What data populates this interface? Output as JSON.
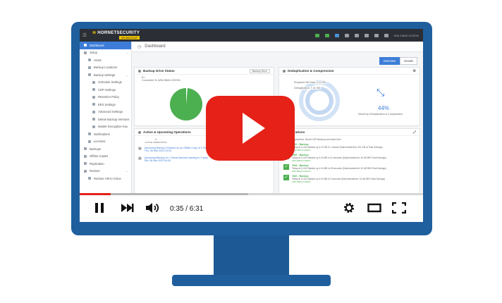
{
  "app": {
    "brand_line1": "HORNETSECURITY",
    "brand_line2": "VM BACKUP",
    "user": "WIN-DBA0-OCEDN"
  },
  "sidebar": {
    "items": [
      {
        "label": "Dashboard",
        "level": 1,
        "active": true
      },
      {
        "label": "Setup",
        "level": 1,
        "chevron": true
      },
      {
        "label": "Hosts",
        "level": 2
      },
      {
        "label": "Backup Locations",
        "level": 2
      },
      {
        "label": "Backup Settings",
        "level": 2,
        "chevron": true
      },
      {
        "label": "Schedule Settings",
        "level": 3
      },
      {
        "label": "CDP Settings",
        "level": 3
      },
      {
        "label": "Retention Policy",
        "level": 3
      },
      {
        "label": "EES Settings",
        "level": 3
      },
      {
        "label": "Advanced Settings",
        "level": 3
      },
      {
        "label": "Delete Backup Versions",
        "level": 3
      },
      {
        "label": "Master Encryption Key",
        "level": 3
      },
      {
        "label": "Notifications",
        "level": 2
      },
      {
        "label": "Licenses",
        "level": 2
      },
      {
        "label": "Backups",
        "level": 1
      },
      {
        "label": "Offsite Copies",
        "level": 1
      },
      {
        "label": "Replication",
        "level": 1
      },
      {
        "label": "Restore",
        "level": 1,
        "chevron": true
      },
      {
        "label": "Restore VM to Clone",
        "level": 2
      }
    ]
  },
  "page": {
    "title": "Dashboard",
    "tabs": [
      "Overview",
      "Details"
    ]
  },
  "panels": {
    "drive_status": {
      "title": "Backup Drive Status",
      "button": "Backup Drive",
      "drive_letter": "E:\\",
      "connected": "Connected To WIN-DBA0-OCEDN"
    },
    "dedup": {
      "title": "Deduplication & Compression",
      "prepared_label": "Prepared VM Data: 9.14 GB",
      "dedup_label": "Deduplication: 7.41 GB",
      "percent": "44%",
      "caption": "Saved by Deduplication & Compression"
    },
    "active_ops": {
      "title": "Active & Upcoming Operations",
      "active_count": "0",
      "active_label": "ACTIVE OPERATIONS",
      "queued_count": "0",
      "queued_label": "QUEUED OPERATIONS",
      "rows": [
        {
          "text": "Upcoming Backup Followed by an Offsite Copy of 3 VMs in 2 hours",
          "date": "Thu, 06 Mar 2023 23:00"
        },
        {
          "text": "Upcoming Backup of 1 Virtual Machine starting in 2 days",
          "date": "Sat, 08 Mar 2023 00:00"
        }
      ]
    },
    "recent_ops": {
      "title": "Operations",
      "notice": "Last 24 Operations. Not all CDP Backups are listed here",
      "rows": [
        {
          "title": "VM2 - Backup",
          "text": "Today at 11:45: Backed up 4.13 GB in 1 minute (Data transferred: 401 GB at Total Savings)",
          "host": "WIN-DBA0-OCEDN"
        },
        {
          "title": "VM2 - Backup",
          "text": "Today at 11:45: Backed up 4.04 MB in 41 seconds (Data transferred: 42 kB 98% Total Savings)",
          "host": "WIN-DBA0-OCEDN"
        },
        {
          "title": "VM4 - Backup",
          "text": "Today at 11:45: Backed up 4.04 MB in 28 seconds (Data transferred: 42 kB 98% Total Savings)",
          "host": "WIN-DBA0-OCEDN"
        },
        {
          "title": "VM2 - Backup",
          "text": "Today at 11:45: Backed up 4.04 MB in 3 seconds (Data transferred: 42 kB 98% Total Savings)",
          "host": "WIN-DBA0-OCEDN"
        }
      ]
    }
  },
  "player": {
    "time": "0:35 / 6:31",
    "progress_played": 0.09,
    "progress_buffered": 0.49,
    "brand_red": "#e62117"
  }
}
